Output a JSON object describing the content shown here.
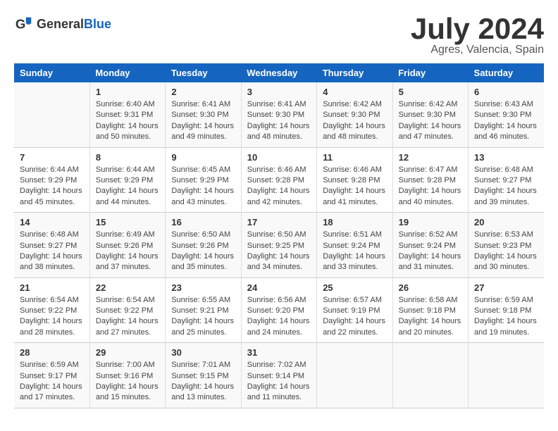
{
  "header": {
    "logo_general": "General",
    "logo_blue": "Blue",
    "month_year": "July 2024",
    "location": "Agres, Valencia, Spain"
  },
  "days_of_week": [
    "Sunday",
    "Monday",
    "Tuesday",
    "Wednesday",
    "Thursday",
    "Friday",
    "Saturday"
  ],
  "weeks": [
    [
      {
        "day": "",
        "info": ""
      },
      {
        "day": "1",
        "info": "Sunrise: 6:40 AM\nSunset: 9:31 PM\nDaylight: 14 hours\nand 50 minutes."
      },
      {
        "day": "2",
        "info": "Sunrise: 6:41 AM\nSunset: 9:30 PM\nDaylight: 14 hours\nand 49 minutes."
      },
      {
        "day": "3",
        "info": "Sunrise: 6:41 AM\nSunset: 9:30 PM\nDaylight: 14 hours\nand 48 minutes."
      },
      {
        "day": "4",
        "info": "Sunrise: 6:42 AM\nSunset: 9:30 PM\nDaylight: 14 hours\nand 48 minutes."
      },
      {
        "day": "5",
        "info": "Sunrise: 6:42 AM\nSunset: 9:30 PM\nDaylight: 14 hours\nand 47 minutes."
      },
      {
        "day": "6",
        "info": "Sunrise: 6:43 AM\nSunset: 9:30 PM\nDaylight: 14 hours\nand 46 minutes."
      }
    ],
    [
      {
        "day": "7",
        "info": "Sunrise: 6:44 AM\nSunset: 9:29 PM\nDaylight: 14 hours\nand 45 minutes."
      },
      {
        "day": "8",
        "info": "Sunrise: 6:44 AM\nSunset: 9:29 PM\nDaylight: 14 hours\nand 44 minutes."
      },
      {
        "day": "9",
        "info": "Sunrise: 6:45 AM\nSunset: 9:29 PM\nDaylight: 14 hours\nand 43 minutes."
      },
      {
        "day": "10",
        "info": "Sunrise: 6:46 AM\nSunset: 9:28 PM\nDaylight: 14 hours\nand 42 minutes."
      },
      {
        "day": "11",
        "info": "Sunrise: 6:46 AM\nSunset: 9:28 PM\nDaylight: 14 hours\nand 41 minutes."
      },
      {
        "day": "12",
        "info": "Sunrise: 6:47 AM\nSunset: 9:28 PM\nDaylight: 14 hours\nand 40 minutes."
      },
      {
        "day": "13",
        "info": "Sunrise: 6:48 AM\nSunset: 9:27 PM\nDaylight: 14 hours\nand 39 minutes."
      }
    ],
    [
      {
        "day": "14",
        "info": "Sunrise: 6:48 AM\nSunset: 9:27 PM\nDaylight: 14 hours\nand 38 minutes."
      },
      {
        "day": "15",
        "info": "Sunrise: 6:49 AM\nSunset: 9:26 PM\nDaylight: 14 hours\nand 37 minutes."
      },
      {
        "day": "16",
        "info": "Sunrise: 6:50 AM\nSunset: 9:26 PM\nDaylight: 14 hours\nand 35 minutes."
      },
      {
        "day": "17",
        "info": "Sunrise: 6:50 AM\nSunset: 9:25 PM\nDaylight: 14 hours\nand 34 minutes."
      },
      {
        "day": "18",
        "info": "Sunrise: 6:51 AM\nSunset: 9:24 PM\nDaylight: 14 hours\nand 33 minutes."
      },
      {
        "day": "19",
        "info": "Sunrise: 6:52 AM\nSunset: 9:24 PM\nDaylight: 14 hours\nand 31 minutes."
      },
      {
        "day": "20",
        "info": "Sunrise: 6:53 AM\nSunset: 9:23 PM\nDaylight: 14 hours\nand 30 minutes."
      }
    ],
    [
      {
        "day": "21",
        "info": "Sunrise: 6:54 AM\nSunset: 9:22 PM\nDaylight: 14 hours\nand 28 minutes."
      },
      {
        "day": "22",
        "info": "Sunrise: 6:54 AM\nSunset: 9:22 PM\nDaylight: 14 hours\nand 27 minutes."
      },
      {
        "day": "23",
        "info": "Sunrise: 6:55 AM\nSunset: 9:21 PM\nDaylight: 14 hours\nand 25 minutes."
      },
      {
        "day": "24",
        "info": "Sunrise: 6:56 AM\nSunset: 9:20 PM\nDaylight: 14 hours\nand 24 minutes."
      },
      {
        "day": "25",
        "info": "Sunrise: 6:57 AM\nSunset: 9:19 PM\nDaylight: 14 hours\nand 22 minutes."
      },
      {
        "day": "26",
        "info": "Sunrise: 6:58 AM\nSunset: 9:18 PM\nDaylight: 14 hours\nand 20 minutes."
      },
      {
        "day": "27",
        "info": "Sunrise: 6:59 AM\nSunset: 9:18 PM\nDaylight: 14 hours\nand 19 minutes."
      }
    ],
    [
      {
        "day": "28",
        "info": "Sunrise: 6:59 AM\nSunset: 9:17 PM\nDaylight: 14 hours\nand 17 minutes."
      },
      {
        "day": "29",
        "info": "Sunrise: 7:00 AM\nSunset: 9:16 PM\nDaylight: 14 hours\nand 15 minutes."
      },
      {
        "day": "30",
        "info": "Sunrise: 7:01 AM\nSunset: 9:15 PM\nDaylight: 14 hours\nand 13 minutes."
      },
      {
        "day": "31",
        "info": "Sunrise: 7:02 AM\nSunset: 9:14 PM\nDaylight: 14 hours\nand 11 minutes."
      },
      {
        "day": "",
        "info": ""
      },
      {
        "day": "",
        "info": ""
      },
      {
        "day": "",
        "info": ""
      }
    ]
  ]
}
